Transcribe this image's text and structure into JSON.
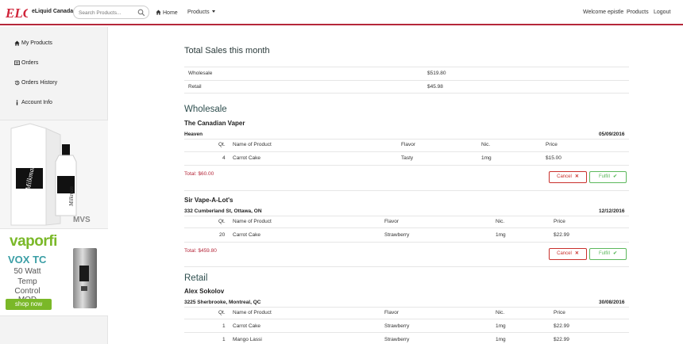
{
  "navbar": {
    "brand": "eLiquid Canada",
    "search_placeholder": "Search Products...",
    "home": "Home",
    "products": "Products",
    "welcome": "Welcome epistle",
    "products_right": "Products",
    "logout": "Logout",
    "accent": "#b5273a"
  },
  "sidebar": {
    "items": [
      {
        "label": "My Products",
        "icon": "home-icon"
      },
      {
        "label": "Orders",
        "icon": "cart-icon"
      },
      {
        "label": "Orders History",
        "icon": "history-icon"
      },
      {
        "label": "Account Info",
        "icon": "info-icon"
      }
    ]
  },
  "ads": {
    "vaporfi": {
      "logo": "vaporfi",
      "headline": "VOX TC",
      "line1": "50 Watt",
      "line2": "Temp",
      "line3": "Control MOD",
      "cta": "shop now"
    }
  },
  "summary": {
    "title": "Total Sales this month",
    "rows": [
      {
        "label": "Wholesale",
        "value": "$519.80"
      },
      {
        "label": "Retail",
        "value": "$45.98"
      }
    ]
  },
  "wholesale": {
    "heading": "Wholesale",
    "orders": [
      {
        "customer": "The Canadian Vaper",
        "address": "Heaven",
        "date": "05/09/2016",
        "headers": [
          "Qt.",
          "Name of Product",
          "Flavor",
          "Nic.",
          "Price"
        ],
        "items": [
          {
            "qty": "4",
            "product": "Carrot Cake",
            "flavor": "Tasty",
            "nic": "1mg",
            "price": "$15.00"
          }
        ],
        "total": "Total:  $60.00",
        "cancel": "Cancel",
        "fulfill": "Fulfill"
      },
      {
        "customer": "Sir Vape-A-Lot's",
        "address": "332 Cumberland St, Ottawa, ON",
        "date": "12/12/2016",
        "headers": [
          "Qt.",
          "Name of Product",
          "Flavor",
          "Nic.",
          "Price"
        ],
        "items": [
          {
            "qty": "20",
            "product": "Carrot Cake",
            "flavor": "Strawberry",
            "nic": "1mg",
            "price": "$22.99"
          }
        ],
        "total": "Total:  $459.80",
        "cancel": "Cancel",
        "fulfill": "Fulfill"
      }
    ]
  },
  "retail": {
    "heading": "Retail",
    "orders": [
      {
        "customer": "Alex Sokolov",
        "address": "3225 Sherbrooke, Montreal, QC",
        "date": "30/08/2016",
        "headers": [
          "Qt.",
          "Name of Product",
          "Flavor",
          "Nic.",
          "Price"
        ],
        "items": [
          {
            "qty": "1",
            "product": "Carrot Cake",
            "flavor": "Strawberry",
            "nic": "1mg",
            "price": "$22.99"
          },
          {
            "qty": "1",
            "product": "Mango Lassi",
            "flavor": "Strawberry",
            "nic": "1mg",
            "price": "$22.99"
          }
        ]
      }
    ]
  }
}
